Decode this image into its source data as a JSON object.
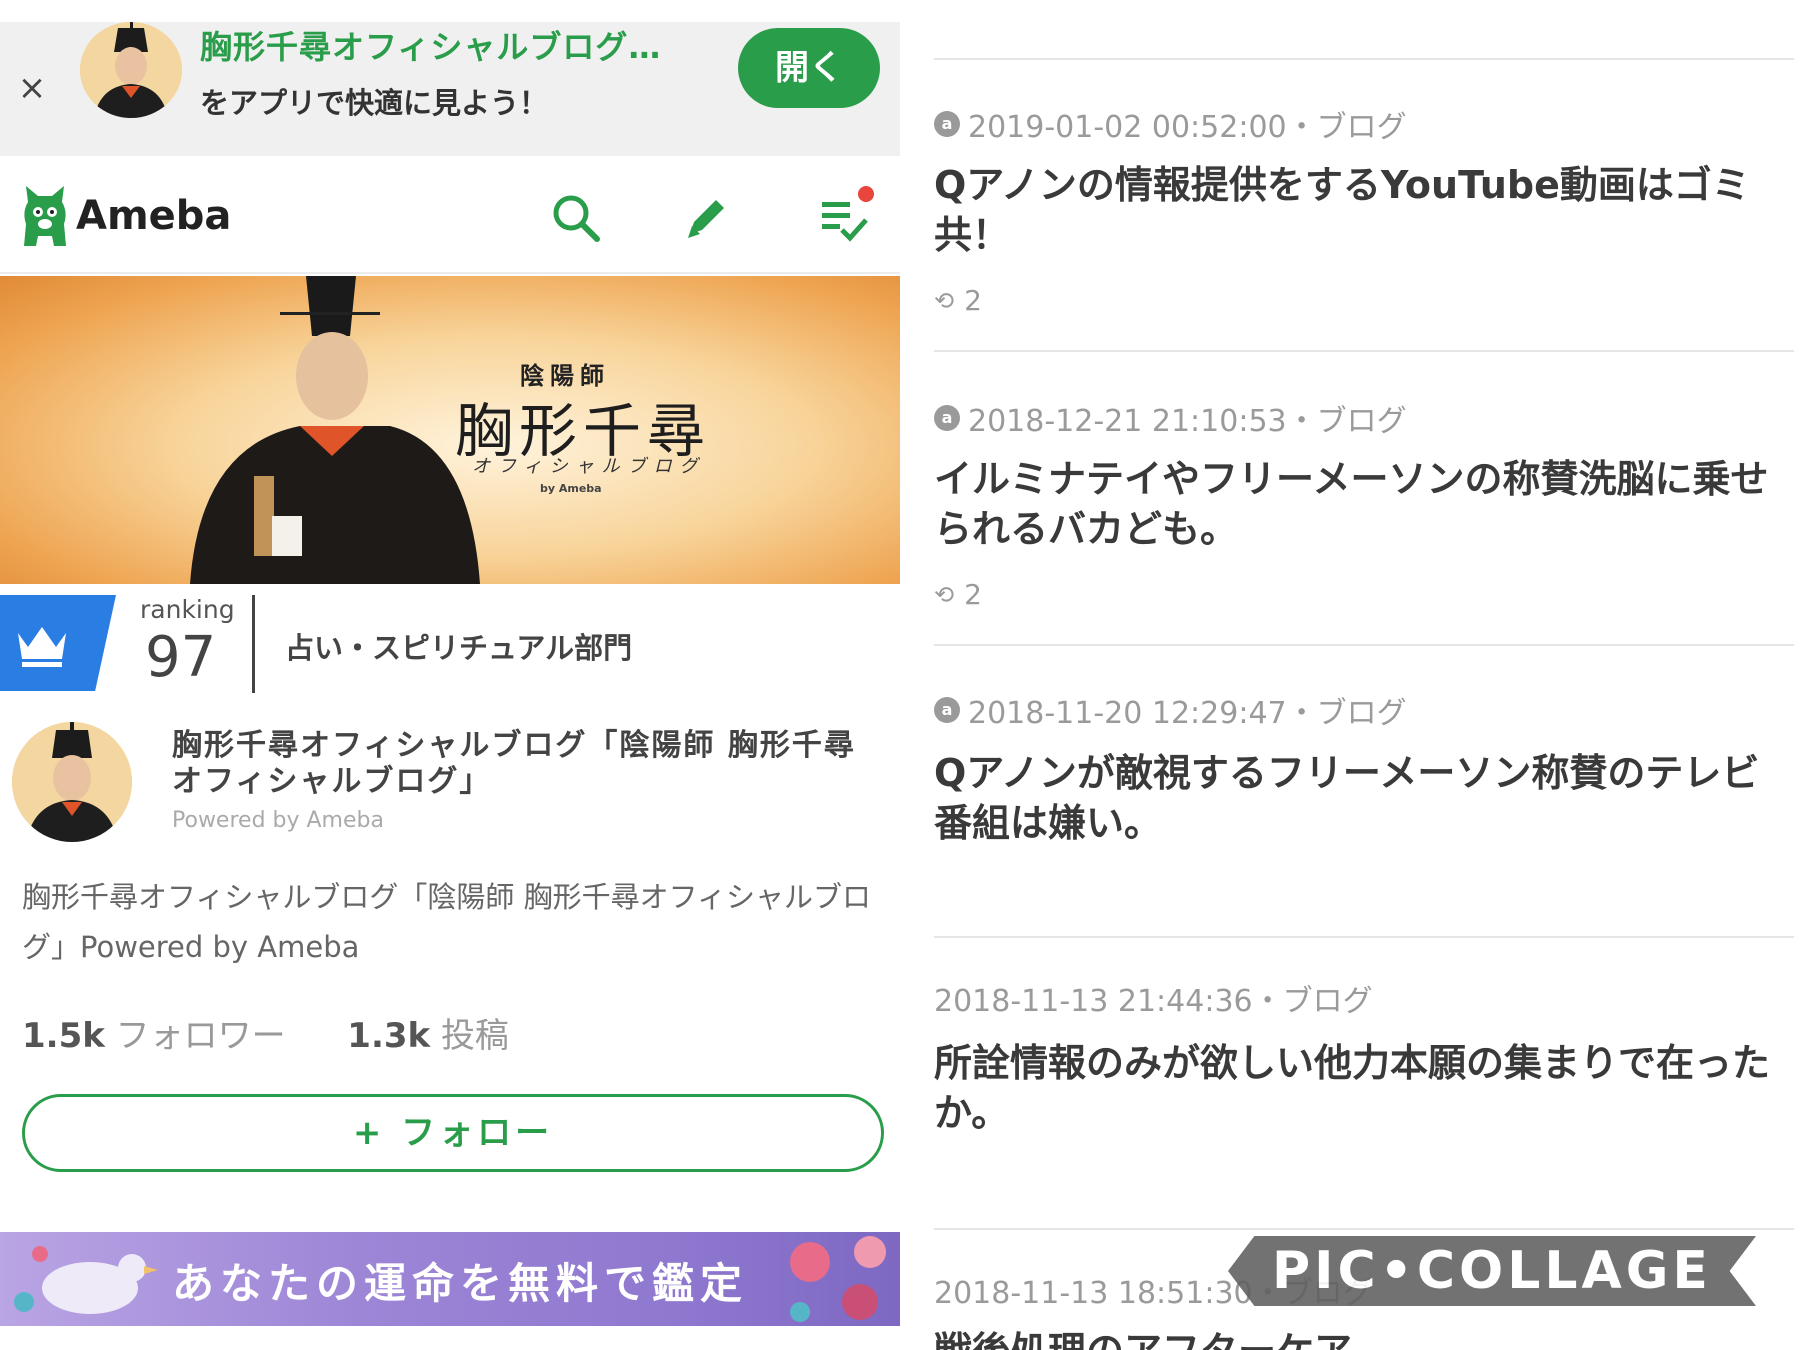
{
  "app_banner": {
    "title": "胸形千尋オフィシャルブログ…",
    "subtitle": "をアプリで快適に見よう！",
    "open_label": "開く"
  },
  "topbar": {
    "logo_text": "Ameba"
  },
  "header_image": {
    "small_title": "陰陽師",
    "name": "胸形千尋",
    "subtitle": "オフィシャルブログ",
    "by": "by Ameba"
  },
  "ranking": {
    "label": "ranking",
    "value": "97",
    "category": "占い・スピリチュアル部門"
  },
  "profile": {
    "title": "胸形千尋オフィシャルブログ「陰陽師 胸形千尋オフィシャルブログ」",
    "powered": "Powered by Ameba",
    "description": "胸形千尋オフィシャルブログ「陰陽師 胸形千尋オフィシャルブログ」Powered by Ameba",
    "followers_count": "1.5k",
    "followers_label": "フォロワー",
    "posts_count": "1.3k",
    "posts_label": "投稿",
    "follow_label": "+ フォロー"
  },
  "ad": {
    "text": "あなたの運命を無料で鑑定"
  },
  "entries": [
    {
      "meta": "2019-01-02 00:52:00・ブログ",
      "title": "Qアノンの情報提供をするYouTube動画はゴミ共！",
      "reblogs": "2"
    },
    {
      "meta": "2018-12-21 21:10:53・ブログ",
      "title": "イルミナテイやフリーメーソンの称賛洗脳に乗せられるバカども。",
      "reblogs": "2"
    },
    {
      "meta": "2018-11-20 12:29:47・ブログ",
      "title": "Qアノンが敵視するフリーメーソン称賛のテレビ番組は嫌い。"
    },
    {
      "meta": "2018-11-13 21:44:36・ブログ",
      "title": "所詮情報のみが欲しい他力本願の集まりで在ったか。"
    },
    {
      "meta": "2018-11-13 18:51:30・ブログ",
      "title": "戦後処理のアフターケア"
    }
  ],
  "watermark": "PIC•COLLAGE",
  "colors": {
    "brand_green": "#2a9d4a",
    "rank_blue": "#2a7ee3",
    "notification_red": "#e8453c"
  }
}
